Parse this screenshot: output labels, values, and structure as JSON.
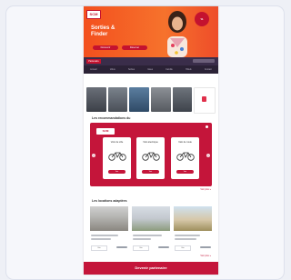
{
  "hero": {
    "logo_text": "SCM",
    "title_line1": "Sorties &",
    "title_line2": "Finder",
    "button1": "Découvrir",
    "button2": "Réserver",
    "badge": "%"
  },
  "subbar": {
    "tag": "Partenaire"
  },
  "nav": {
    "items": [
      "Accueil",
      "Vélos",
      "Sorties",
      "Idées",
      "Famille",
      "Hôtels",
      "Contact"
    ]
  },
  "sections": {
    "recommendations_title": "Les recommandations du",
    "promo_logo": "SCM",
    "products": [
      {
        "title": "Vélo de ville",
        "button": "Voir"
      },
      {
        "title": "Vélo électrique",
        "button": "Voir"
      },
      {
        "title": "Vélo de route",
        "button": "Voir"
      }
    ],
    "more_label": "Voir plus »",
    "houses_title": "Les locations adaptées",
    "house_button": "Voir",
    "more_label2": "Voir plus »"
  },
  "footer": {
    "cta": "Devenir partenaire"
  },
  "colors": {
    "brand": "#c4153a",
    "hero": "#f3501e",
    "nav": "#2b2236"
  }
}
